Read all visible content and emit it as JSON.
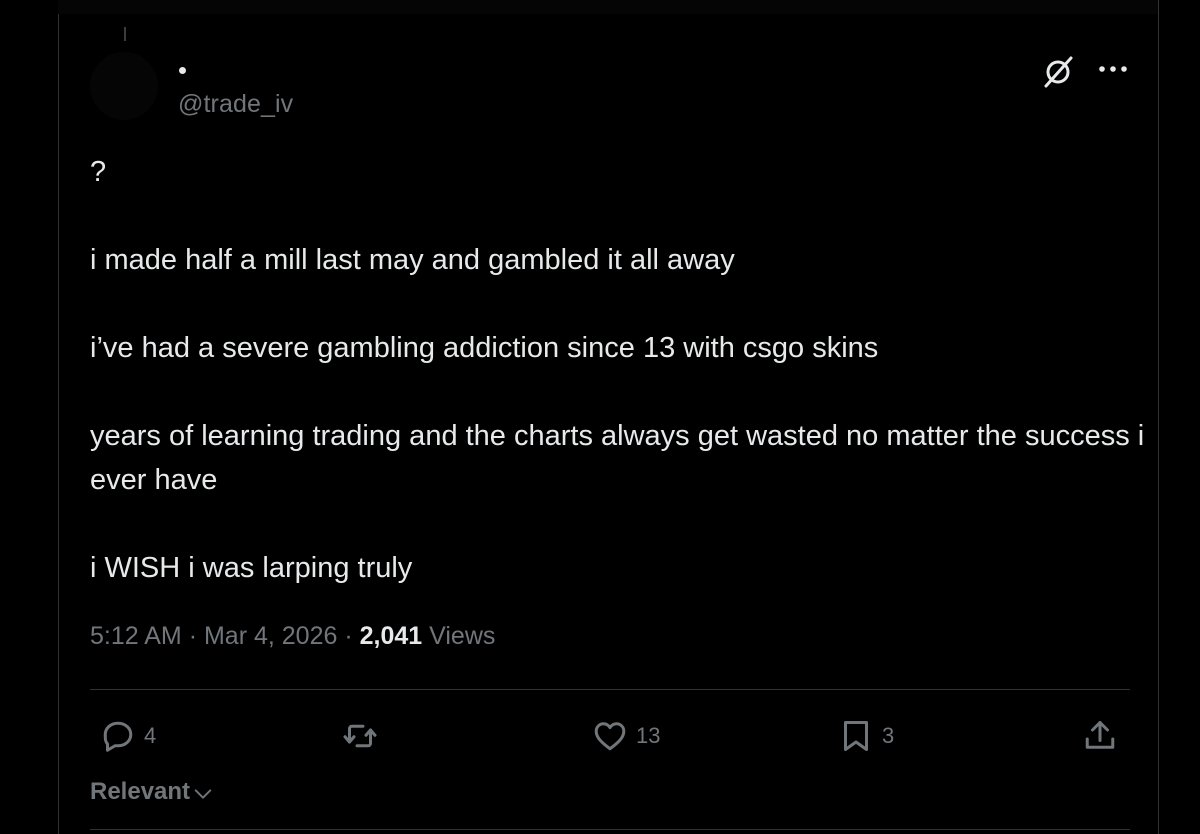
{
  "tweet": {
    "handle": "@trade_iv",
    "paragraphs": [
      "?",
      "i made half a mill last may and gambled it all away",
      "i’ve had a severe gambling addiction since 13 with csgo skins",
      "years of learning trading and the charts always get wasted no matter the success i ever have",
      "i WISH i was larping truly"
    ],
    "time": "5:12 AM",
    "separator": "·",
    "date": "Mar 4, 2026",
    "views_count": "2,041",
    "views_label": "Views"
  },
  "actions": {
    "reply_count": "4",
    "retweet_count": "",
    "like_count": "13",
    "bookmark_count": "3"
  },
  "sort": {
    "label": "Relevant"
  },
  "icons": {
    "header": [
      "grok-icon",
      "more-icon"
    ],
    "actions": [
      "reply-icon",
      "retweet-icon",
      "like-icon",
      "bookmark-icon",
      "share-icon"
    ],
    "sort": "chevron-down-icon"
  },
  "colors": {
    "background": "#000000",
    "text": "#e7e9ea",
    "muted": "#71767b",
    "border": "#2f3336"
  }
}
